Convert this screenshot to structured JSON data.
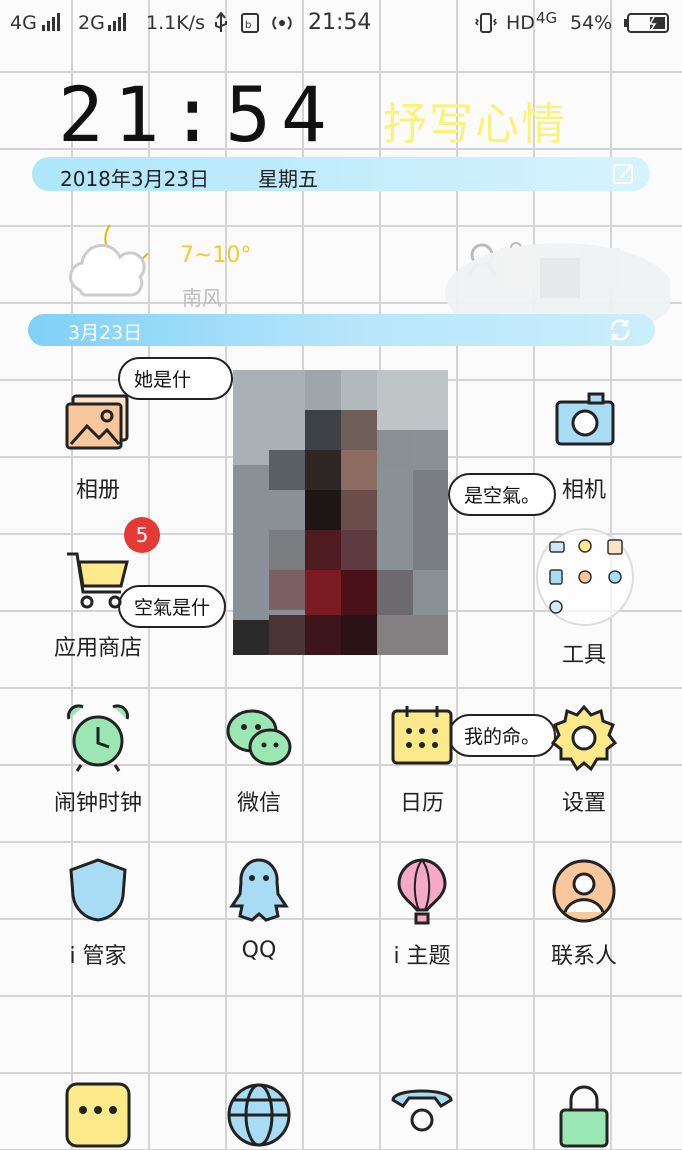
{
  "status_bar": {
    "net1": "4G",
    "net2": "2G",
    "speed": "1.1K/s",
    "time": "21:54",
    "hd": "HD",
    "net3": "4G",
    "battery": "54%"
  },
  "widget": {
    "clock": "21:54",
    "mood": "抒写心情",
    "date": "2018年3月23日",
    "weekday": "星期五"
  },
  "weather": {
    "temp": "7~10°",
    "wind": "南风",
    "bar_date": "3月23日"
  },
  "bubbles": {
    "b1": "她是什",
    "b2": "是空氣。",
    "b3": "空氣是什",
    "b4": "我的命。"
  },
  "apps": {
    "gallery": "相册",
    "camera": "相机",
    "store": "应用商店",
    "store_badge": "5",
    "tools": "工具",
    "clock": "闹钟时钟",
    "wechat": "微信",
    "calendar": "日历",
    "settings": "设置",
    "manager": "i 管家",
    "qq": "QQ",
    "theme": "i 主题",
    "contacts": "联系人"
  },
  "colors": {
    "mood_yellow": "#fbf27a",
    "bar_blue": "#aee6fb",
    "badge_red": "#e53935"
  }
}
